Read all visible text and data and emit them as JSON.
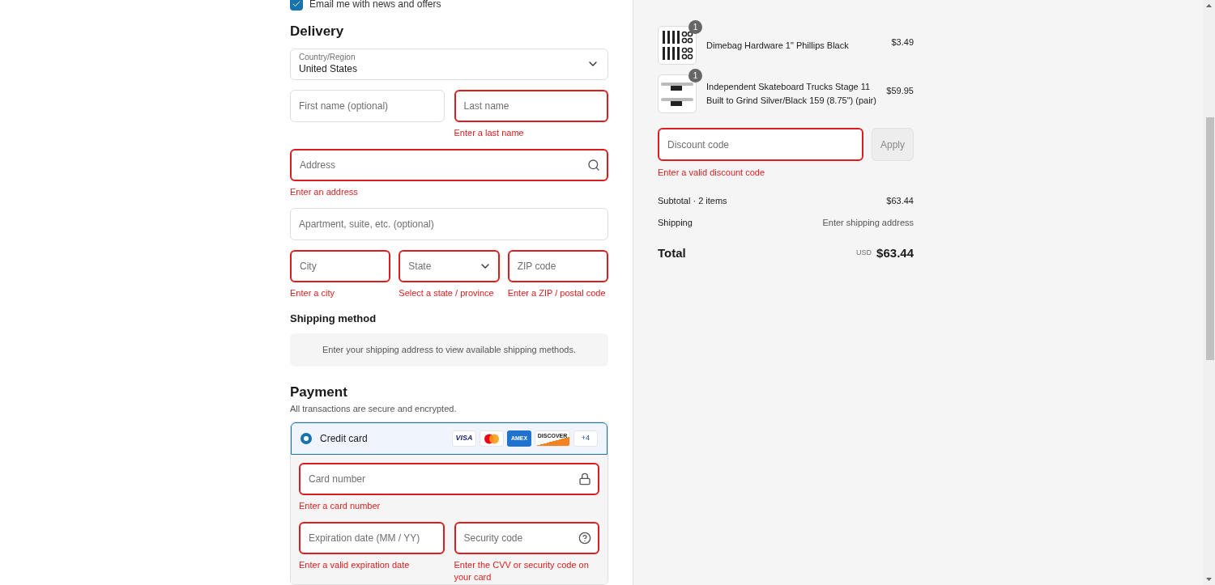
{
  "newsletter": {
    "label": "Email me with news and offers",
    "checked": true
  },
  "delivery": {
    "title": "Delivery",
    "country": {
      "label": "Country/Region",
      "value": "United States"
    },
    "rows": [
      [
        {
          "kind": "text",
          "placeholder": "First name (optional)"
        },
        {
          "kind": "text",
          "placeholder": "Last name",
          "error": "Enter a last name"
        }
      ],
      [
        {
          "kind": "search",
          "placeholder": "Address",
          "error": "Enter an address"
        }
      ],
      [
        {
          "kind": "text",
          "placeholder": "Apartment, suite, etc. (optional)"
        }
      ],
      [
        {
          "kind": "text",
          "placeholder": "City",
          "error": "Enter a city"
        },
        {
          "kind": "select",
          "placeholder": "State",
          "error": "Select a state / province"
        },
        {
          "kind": "text",
          "placeholder": "ZIP code",
          "error": "Enter a ZIP / postal code"
        }
      ]
    ]
  },
  "shipping_method": {
    "title": "Shipping method",
    "message": "Enter your shipping address to view available shipping methods."
  },
  "payment": {
    "title": "Payment",
    "subtitle": "All transactions are secure and encrypted.",
    "method": {
      "label": "Credit card",
      "selected": true,
      "brands": [
        {
          "kind": "visa",
          "label": "VISA"
        },
        {
          "kind": "mastercard"
        },
        {
          "kind": "amex",
          "label": "AMEX"
        },
        {
          "kind": "discover",
          "label": "DISCOVER"
        },
        {
          "kind": "more",
          "label": "+4"
        }
      ]
    },
    "rows": [
      [
        {
          "kind": "secure",
          "placeholder": "Card number",
          "error": "Enter a card number"
        }
      ],
      [
        {
          "kind": "text",
          "placeholder": "Expiration date (MM / YY)",
          "error": "Enter a valid expiration date"
        },
        {
          "kind": "help",
          "placeholder": "Security code",
          "error": "Enter the CVV or security code on your card"
        }
      ]
    ]
  },
  "summary": {
    "items": [
      {
        "kind": "hardware",
        "name": "Dimebag Hardware 1\" Phillips Black",
        "quantity": "1",
        "price": "$3.49"
      },
      {
        "kind": "trucks",
        "name": "Independent Skateboard Trucks Stage 11 Built to Grind Silver/Black 159 (8.75\") (pair)",
        "quantity": "1",
        "price": "$59.95"
      }
    ],
    "discount": {
      "placeholder": "Discount code",
      "error": "Enter a valid discount code",
      "button": "Apply"
    },
    "subtotal": {
      "label": "Subtotal · 2 items",
      "value": "$63.44"
    },
    "shipping": {
      "label": "Shipping",
      "value": "Enter shipping address"
    },
    "total": {
      "label": "Total",
      "currency": "USD",
      "value": "$63.44"
    }
  }
}
